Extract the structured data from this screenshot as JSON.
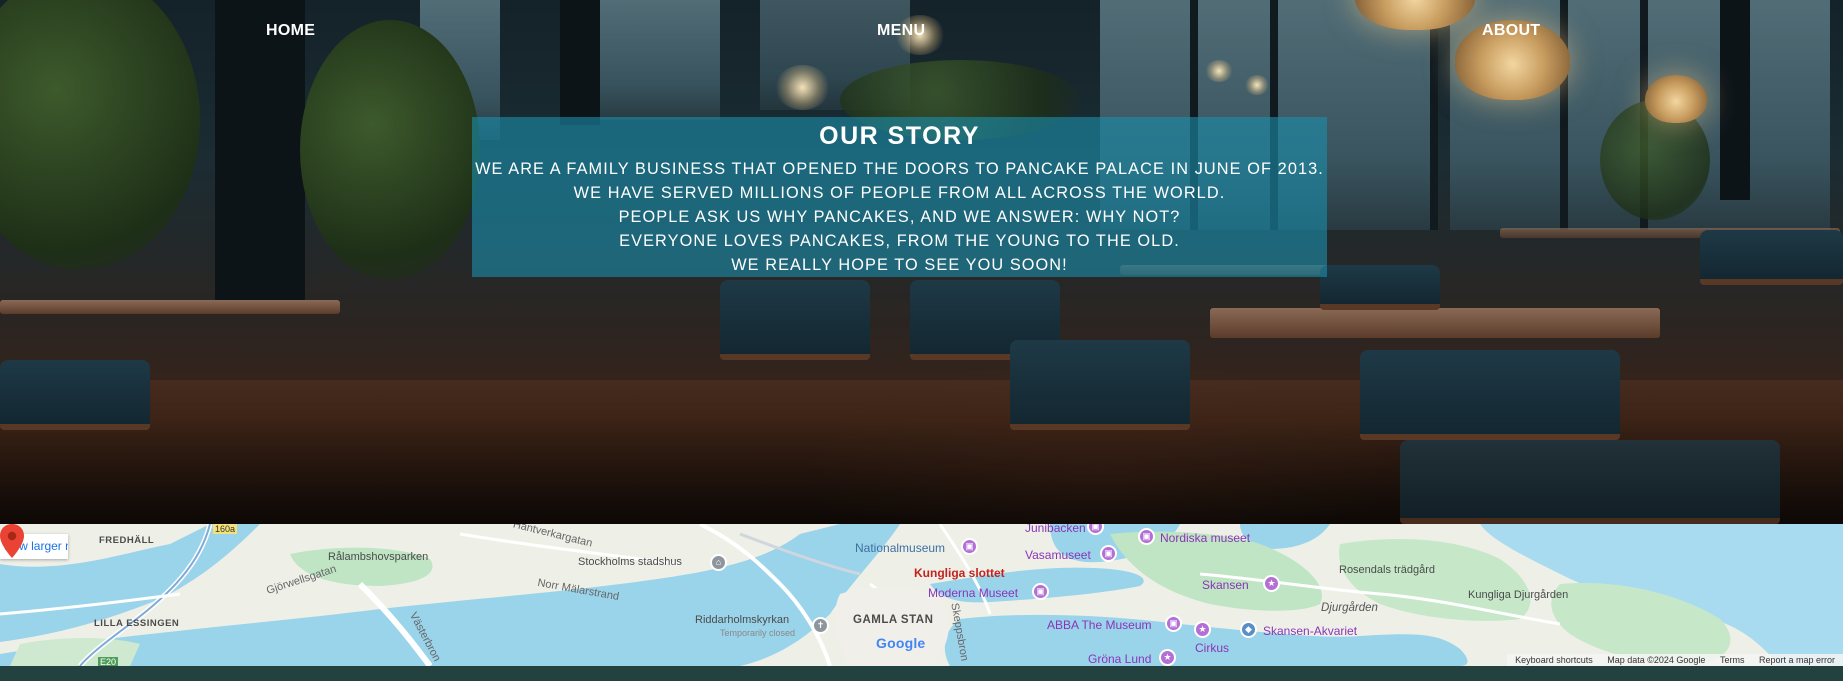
{
  "nav": {
    "home": "HOME",
    "menu": "MENU",
    "about": "ABOUT"
  },
  "story": {
    "title": "OUR STORY",
    "lines": [
      "We are a family business that opened the doors to Pancake Palace in June of 2013.",
      "We have served millions of people from all across the world.",
      "People ask us why pancakes, and we answer: Why not?",
      "Everyone loves pancakes, from the young to the old.",
      "We really hope to see you soon!"
    ]
  },
  "map": {
    "larger_map_link": "View larger map",
    "road_badge": "160a",
    "road_badge_2": "E20",
    "labels": {
      "fredhall": "FREDHÄLL",
      "hantverkargatan": "Hantverkargatan",
      "ralambshovsparken": "Rålambshovsparken",
      "stockholms_stadshus": "Stockholms stadshus",
      "gjorwellsgatan": "Gjörwellsgatan",
      "norr_malarstrand": "Norr Mälarstrand",
      "lilla_essingen": "LILLA ESSINGEN",
      "vastebron": "Västerbron",
      "riddarholmskyrkan": "Riddarholmskyrkan",
      "temporarily_closed": "Temporarily closed",
      "gamla_stan": "GAMLA STAN",
      "nationalmuseum": "Nationalmuseum",
      "kungliga_slottet": "Kungliga slottet",
      "moderna_museet": "Moderna Museet",
      "vasamuseet": "Vasamuseet",
      "junibacken": "Junibacken",
      "nordiska_museet": "Nordiska museet",
      "abba_museum": "ABBA The Museum",
      "skansen": "Skansen",
      "skansen_akvariet": "Skansen-Akvariet",
      "cirkus": "Cirkus",
      "grona_lund": "Gröna Lund",
      "rosendals_tradgard": "Rosendals trädgård",
      "djurgarden": "Djurgården",
      "kungliga_djurgarden": "Kungliga Djurgården",
      "skeppsbron": "Skeppsbron"
    },
    "google": "Google",
    "attribution": {
      "shortcuts": "Keyboard shortcuts",
      "data": "Map data ©2024 Google",
      "terms": "Terms",
      "report": "Report a map error"
    }
  },
  "colors": {
    "story_overlay": "#1b8daa",
    "footer": "#23423f",
    "link_blue": "#1a73e8",
    "poi_purple": "#b36fd6",
    "water": "#9ad4ea",
    "park": "#bfe5c4"
  }
}
